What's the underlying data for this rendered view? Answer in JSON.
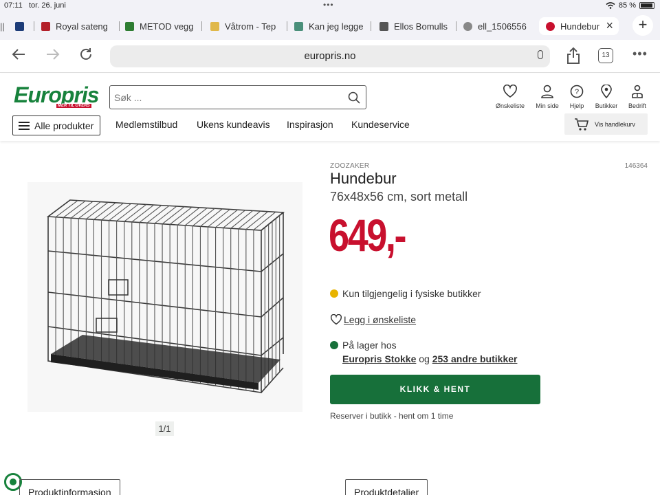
{
  "status_bar": {
    "time": "07:11",
    "date": "tor. 26. juni",
    "battery": "85 %"
  },
  "tabs": [
    {
      "label": "Royal sateng",
      "favicon_color": "#b3202a"
    },
    {
      "label": "METOD vegg",
      "favicon_color": "#2e7d32"
    },
    {
      "label": "Våtrom - Tep",
      "favicon_color": "#e0b84a"
    },
    {
      "label": "Kan jeg legge",
      "favicon_color": "#4a8f7a"
    },
    {
      "label": "Ellos Bomulls",
      "favicon_color": "#555555"
    },
    {
      "label": "ell_1506556",
      "favicon_color": "#888888"
    },
    {
      "label": "Hundebur",
      "favicon_color": "#c8102e"
    }
  ],
  "browser": {
    "url": "europris.no",
    "tab_count": "13"
  },
  "site": {
    "logo_text": "Europris",
    "logo_tagline": "MER TIL OVERS",
    "search_placeholder": "Søk ...",
    "header_icons": [
      {
        "label": "Ønskeliste",
        "icon": "heart-icon"
      },
      {
        "label": "Min side",
        "icon": "user-icon"
      },
      {
        "label": "Hjelp",
        "icon": "help-icon"
      },
      {
        "label": "Butikker",
        "icon": "location-icon"
      },
      {
        "label": "Bedrift",
        "icon": "business-icon"
      }
    ],
    "all_products": "Alle produkter",
    "menu": [
      "Medlemstilbud",
      "Ukens kundeavis",
      "Inspirasjon",
      "Kundeservice"
    ],
    "cart": "Vis handlekurv"
  },
  "product": {
    "brand": "ZOOZAKER",
    "sku": "146364",
    "title": "Hundebur",
    "subtitle": "76x48x56 cm, sort metall",
    "price": "649,-",
    "availability": "Kun tilgjengelig i fysiske butikker",
    "wishlist": "Legg i ønskeliste",
    "stock_label": "På lager hos",
    "store_name": "Europris Stokke",
    "store_and": "og",
    "other_stores": "253 andre butikker",
    "cta": "KLIKK & HENT",
    "reserve_note": "Reserver i butikk - hent om 1 time",
    "image_pager": "1/1",
    "colors": {
      "price": "#c8102e",
      "availability_dot": "#e8b400",
      "stock_dot": "#17703a",
      "cta": "#17703a"
    }
  },
  "bottom_tabs": [
    "Produktinformasjon",
    "Produktdetaljer"
  ]
}
